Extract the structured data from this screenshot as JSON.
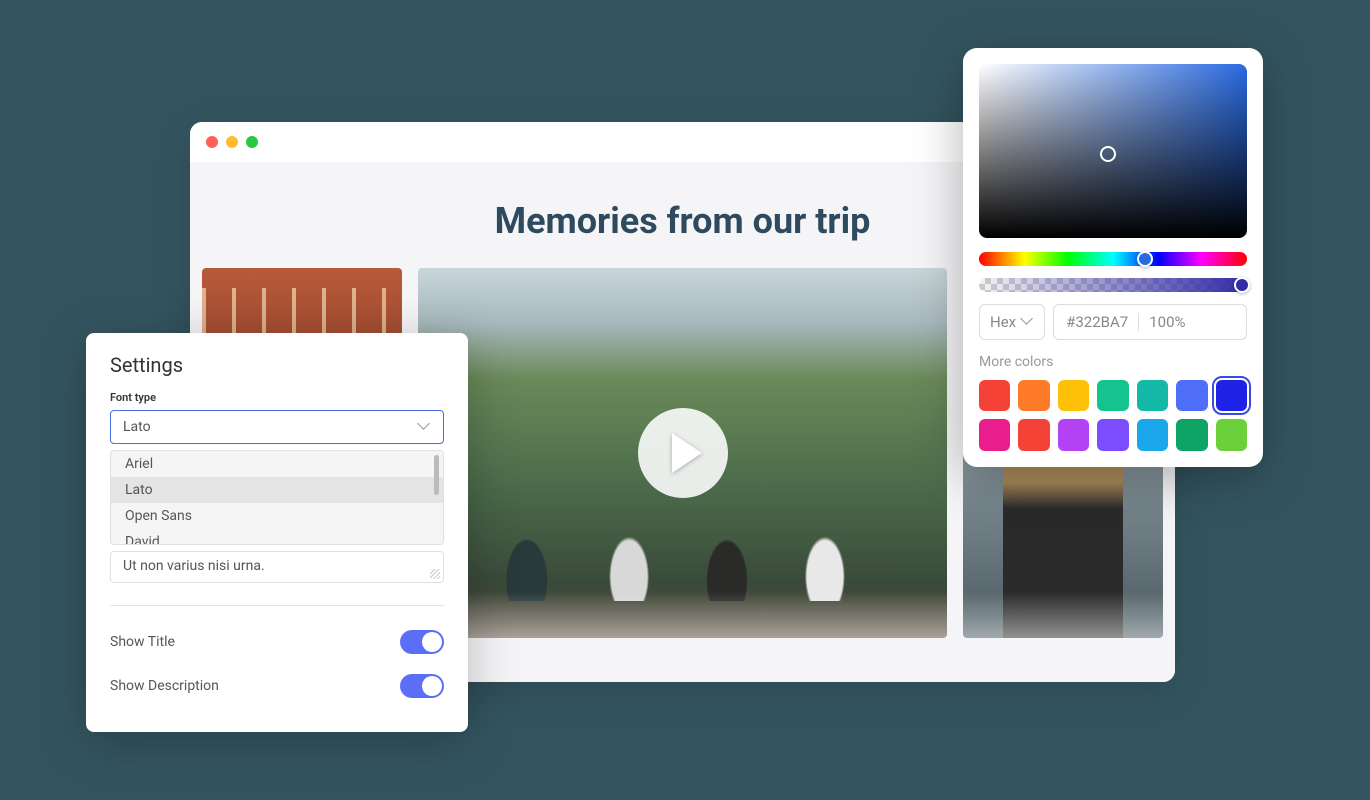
{
  "browser": {
    "page_title": "Memories from our trip"
  },
  "settings": {
    "title": "Settings",
    "font_type_label": "Font type",
    "font_type_value": "Lato",
    "font_options": [
      "Ariel",
      "Lato",
      "Open Sans",
      "David"
    ],
    "font_selected_index": 1,
    "textarea_value": "Ut non varius nisi urna.",
    "toggles": [
      {
        "label": "Show Title",
        "on": true
      },
      {
        "label": "Show Description",
        "on": true
      }
    ]
  },
  "colorpicker": {
    "format_label": "Hex",
    "hex_value": "#322BA7",
    "alpha_value": "100%",
    "more_colors_label": "More colors",
    "swatches": [
      "#F44336",
      "#FF7A29",
      "#FFC107",
      "#14C38E",
      "#14B8A6",
      "#4F6EF7",
      "#1E22E6",
      "#E91E8C",
      "#F44336",
      "#B342F5",
      "#7C4DFF",
      "#1AA7EC",
      "#0EA466",
      "#6AD13A"
    ],
    "active_swatch_index": 6
  }
}
